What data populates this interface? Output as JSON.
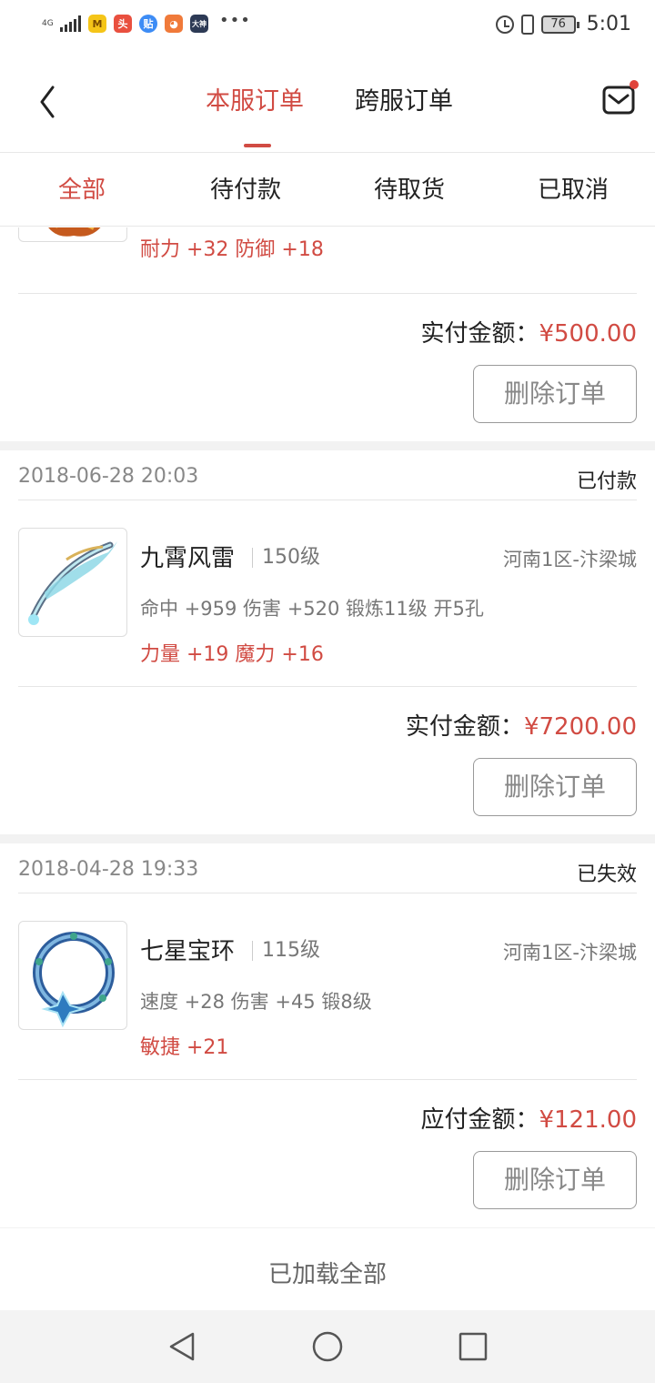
{
  "status_bar": {
    "network": "4G",
    "apps": [
      {
        "icon": "taobao-icon",
        "color": "#f5c518",
        "glyph": "M"
      },
      {
        "icon": "app-red-icon",
        "color": "#e9503f",
        "glyph": "头"
      },
      {
        "icon": "tieba-icon",
        "color": "#3d8cf5",
        "glyph": "贴"
      },
      {
        "icon": "app-orange-icon",
        "color": "#f07a3a",
        "glyph": "◕"
      },
      {
        "icon": "dashen-icon",
        "color": "#2d3a55",
        "glyph": "大神"
      }
    ],
    "more": "•••",
    "battery": "76",
    "time": "5:01"
  },
  "header": {
    "tabs": [
      {
        "label": "本服订单",
        "active": true
      },
      {
        "label": "跨服订单",
        "active": false
      }
    ]
  },
  "filters": [
    {
      "label": "全部",
      "active": true
    },
    {
      "label": "待付款",
      "active": false
    },
    {
      "label": "待取货",
      "active": false
    },
    {
      "label": "已取消",
      "active": false
    }
  ],
  "orders": [
    {
      "bonus": "耐力 +32 防御 +18",
      "pay_label": "实付金额：",
      "pay_amount": "¥500.00",
      "delete_label": "删除订单"
    },
    {
      "date": "2018-06-28 20:03",
      "status": "已付款",
      "name": "九霄风雷",
      "level": "150级",
      "server": "河南1区-汴梁城",
      "stats": "命中 +959 伤害 +520 锻炼11级 开5孔",
      "bonus": "力量 +19 魔力 +16",
      "pay_label": "实付金额：",
      "pay_amount": "¥7200.00",
      "delete_label": "删除订单"
    },
    {
      "date": "2018-04-28 19:33",
      "status": "已失效",
      "name": "七星宝环",
      "level": "115级",
      "server": "河南1区-汴梁城",
      "stats": "速度 +28 伤害 +45 锻8级",
      "bonus": "敏捷 +21",
      "pay_label": "应付金额：",
      "pay_amount": "¥121.00",
      "delete_label": "删除订单"
    }
  ],
  "footer": {
    "loaded_text": "已加载全部"
  },
  "colors": {
    "accent": "#d14b43",
    "text_secondary": "#777777",
    "background": "#f2f2f2"
  }
}
